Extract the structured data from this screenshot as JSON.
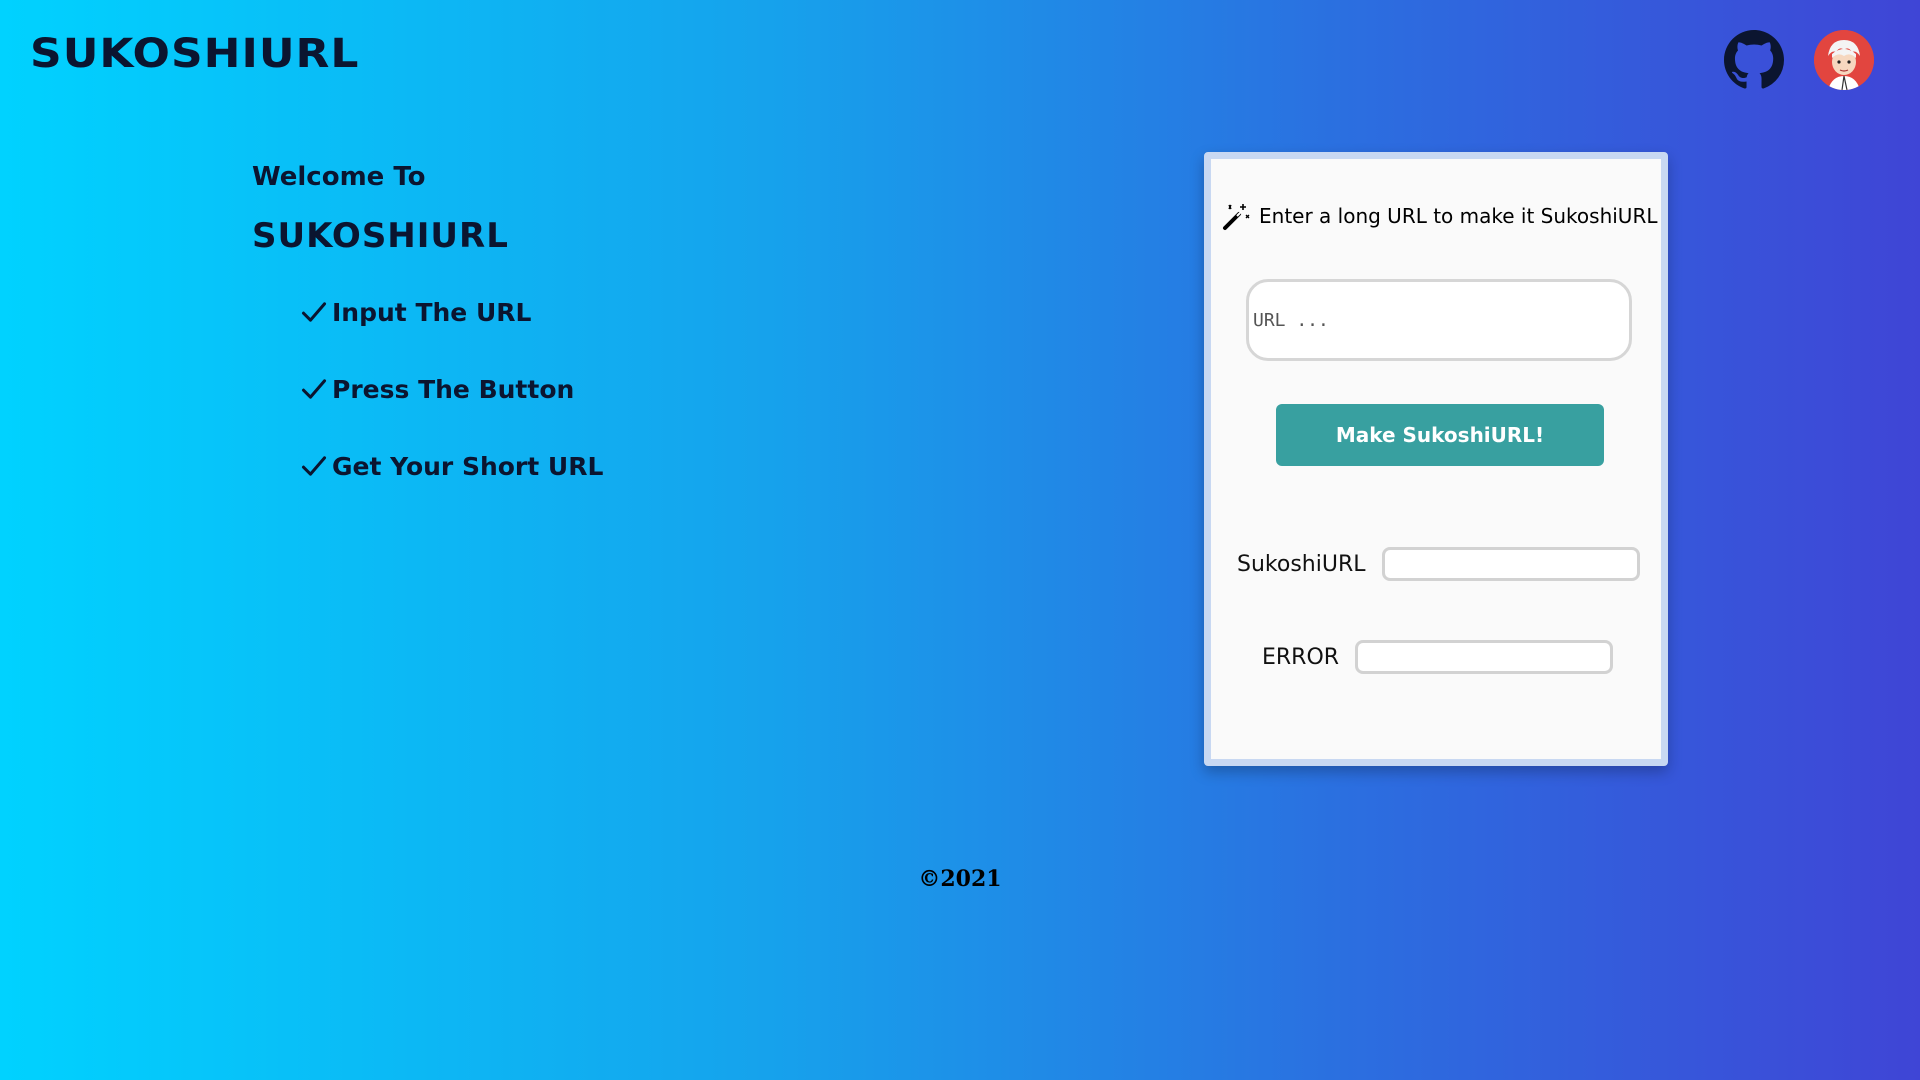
{
  "header": {
    "brand": "SUKOSHIURL",
    "github_icon": "github-icon",
    "avatar_icon": "avatar-icon"
  },
  "hero": {
    "welcome": "Welcome To",
    "brand": "SUKOSHIURL",
    "steps": [
      "Input The URL",
      "Press The Button",
      "Get Your Short URL"
    ],
    "step_icon": "check-icon"
  },
  "form": {
    "heading": "Enter a long URL to make it SukoshiURL",
    "heading_icon": "magic-wand-icon",
    "url_placeholder": "URL ...",
    "url_value": "",
    "submit_label": "Make SukoshiURL!",
    "result_label": "SukoshiURL",
    "result_value": "",
    "error_label": "ERROR",
    "error_value": ""
  },
  "footer": {
    "copyright": "©2021"
  },
  "colors": {
    "gradient_start": "#00d2ff",
    "gradient_end": "#3f45d6",
    "button": "#38a0a0",
    "card_border": "#c8d8f2",
    "text_dark": "#0b1530"
  }
}
